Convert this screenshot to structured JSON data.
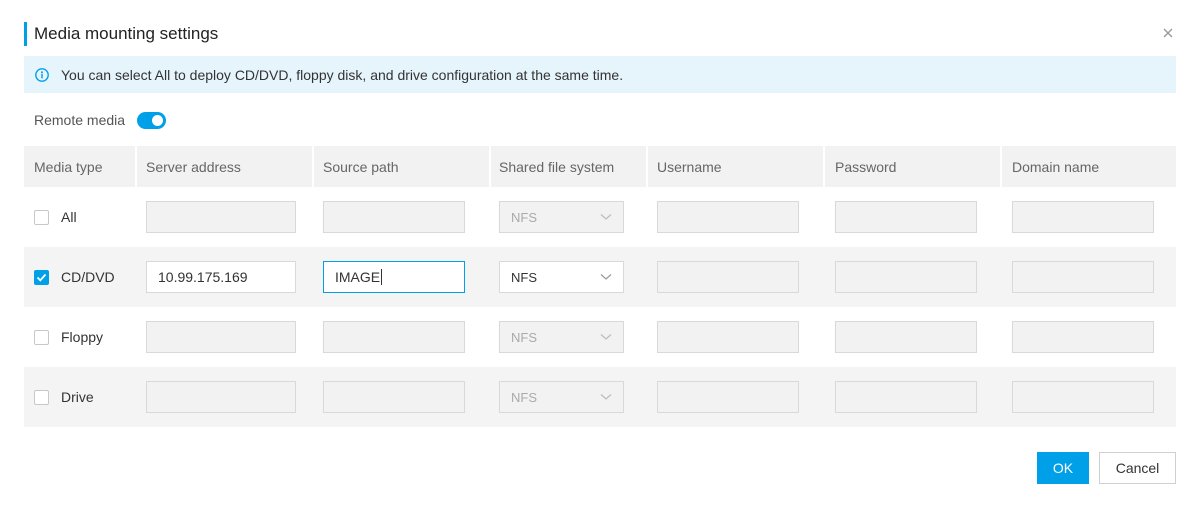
{
  "dialog": {
    "title": "Media mounting settings",
    "close_icon": "close-icon"
  },
  "info": {
    "icon": "info-icon",
    "text": "You can select All to deploy CD/DVD, floppy disk, and drive configuration at the same time."
  },
  "remote_media": {
    "label": "Remote media",
    "enabled": true
  },
  "table": {
    "columns": [
      "Media type",
      "Server address",
      "Source path",
      "Shared file system",
      "Username",
      "Password",
      "Domain name"
    ],
    "rows": [
      {
        "type": "All",
        "checked": false,
        "server_address": "",
        "source_path": "",
        "shared_fs": "NFS",
        "username": "",
        "password": "",
        "domain_name": ""
      },
      {
        "type": "CD/DVD",
        "checked": true,
        "server_address": "10.99.175.169",
        "source_path": "IMAGE",
        "shared_fs": "NFS",
        "username": "",
        "password": "",
        "domain_name": ""
      },
      {
        "type": "Floppy",
        "checked": false,
        "server_address": "",
        "source_path": "",
        "shared_fs": "NFS",
        "username": "",
        "password": "",
        "domain_name": ""
      },
      {
        "type": "Drive",
        "checked": false,
        "server_address": "",
        "source_path": "",
        "shared_fs": "NFS",
        "username": "",
        "password": "",
        "domain_name": ""
      }
    ]
  },
  "footer": {
    "ok_label": "OK",
    "cancel_label": "Cancel"
  },
  "colors": {
    "accent": "#00a0e9",
    "banner_bg": "#e6f4fc",
    "header_bg": "#f2f2f2"
  }
}
